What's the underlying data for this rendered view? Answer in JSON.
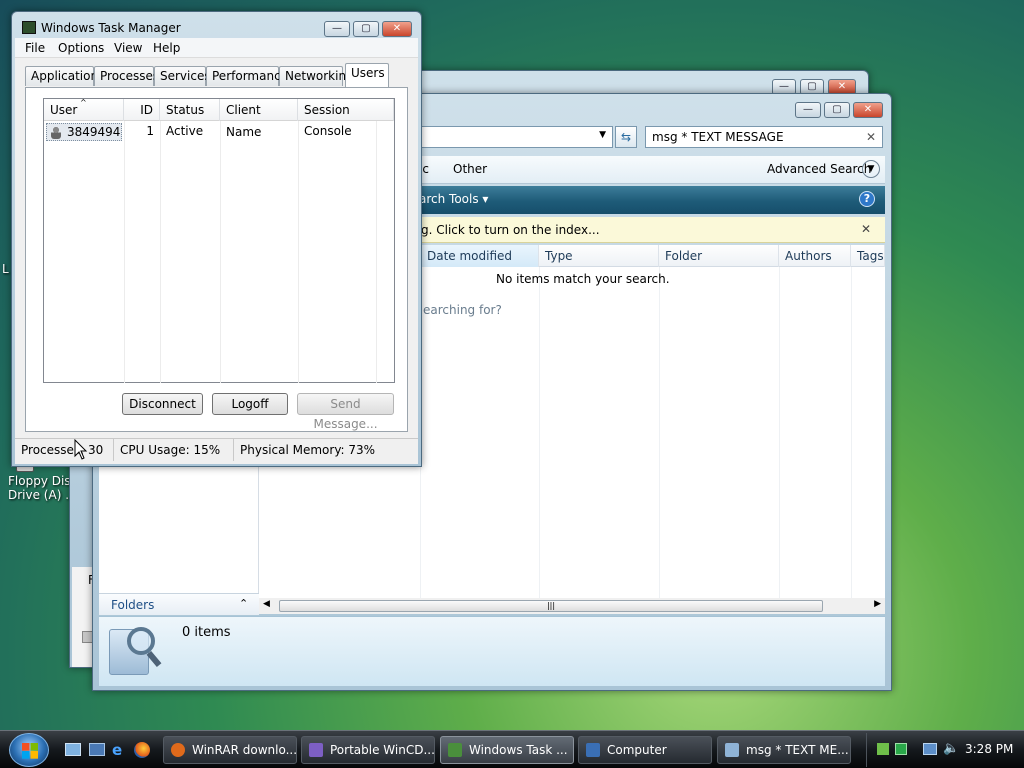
{
  "desktop": {
    "floppy_label_line1": "Floppy Disk",
    "floppy_label_line2": "Drive (A) ...",
    "edge_fragment": "L"
  },
  "search_window": {
    "search_query": "msg * TEXT MESSAGE",
    "menu_partial": "ic",
    "menu_other": "Other",
    "advanced_search": "Advanced Search",
    "search_tools": "arch Tools",
    "info_text": "g.  Click to turn on the index...",
    "columns": [
      "Date modified",
      "Type",
      "Folder",
      "Authors",
      "Tags"
    ],
    "no_items": "No items match your search.",
    "searching_hint": "earching for?",
    "folders_label": "Folders",
    "items_count": "0 items",
    "left_fragment": "F"
  },
  "task_manager": {
    "title": "Windows Task Manager",
    "menu": [
      "File",
      "Options",
      "View",
      "Help"
    ],
    "tabs": [
      "Applications",
      "Processes",
      "Services",
      "Performance",
      "Networking",
      "Users"
    ],
    "active_tab": "Users",
    "columns": [
      "User",
      "ID",
      "Status",
      "Client Name",
      "Session"
    ],
    "rows": [
      {
        "user": "3849494",
        "id": "1",
        "status": "Active",
        "client": "",
        "session": "Console"
      }
    ],
    "buttons": {
      "disconnect": "Disconnect",
      "logoff": "Logoff",
      "send_message": "Send Message..."
    },
    "status": {
      "processes": "Processes: 30",
      "cpu": "CPU Usage: 15%",
      "memory": "Physical Memory: 73%"
    }
  },
  "taskbar": {
    "items": [
      {
        "label": "WinRAR downlo...",
        "icon": "firefox-icon",
        "color": "#e06a1b"
      },
      {
        "label": "Portable WinCD...",
        "icon": "wincdemu-icon",
        "color": "#7d5fc4"
      },
      {
        "label": "Windows Task ...",
        "icon": "task-manager-icon",
        "color": "#4a8f3c"
      },
      {
        "label": "Computer",
        "icon": "computer-icon",
        "color": "#3a6fb5"
      },
      {
        "label": "msg * TEXT ME...",
        "icon": "search-folder-icon",
        "color": "#8fb3d6"
      }
    ],
    "active_item": "Windows Task ...",
    "clock": "3:28 PM"
  }
}
